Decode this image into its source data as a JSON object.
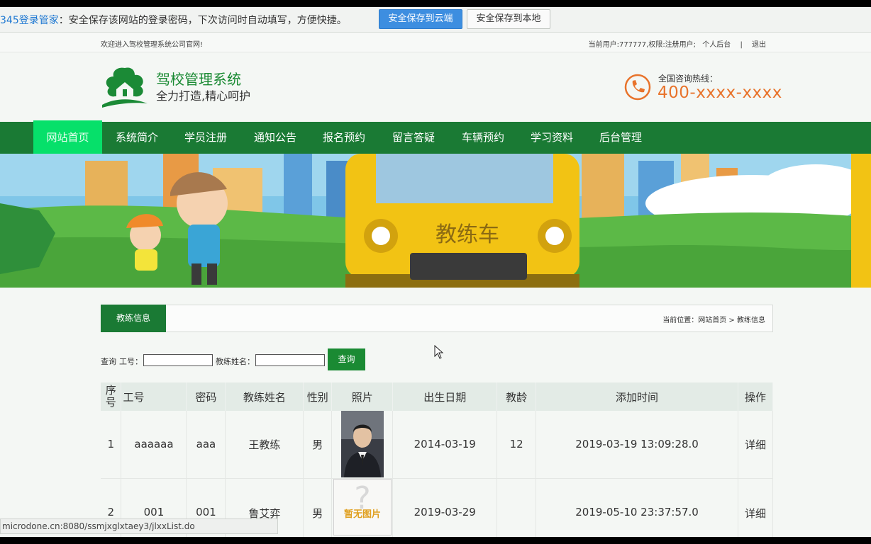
{
  "password_bar": {
    "brand": "345登录管家",
    "message": "：安全保存该网站的登录密码，下次访问时自动填写，方便快捷。",
    "save_cloud": "安全保存到云端",
    "save_local": "安全保存到本地"
  },
  "top_strip": {
    "welcome": "欢迎进入驾校管理系统公司官网!",
    "user_info": "当前用户:777777,权限:注册用户;",
    "personal_backend": "个人后台",
    "separator": "|",
    "logout": "退出"
  },
  "header": {
    "title": "驾校管理系统",
    "slogan": "全力打造,精心呵护",
    "hotline_label": "全国咨询热线：",
    "hotline_number": "400-xxxx-xxxx"
  },
  "nav": {
    "items": [
      "网站首页",
      "系统简介",
      "学员注册",
      "通知公告",
      "报名预约",
      "留言答疑",
      "车辆预约",
      "学习资料",
      "后台管理"
    ]
  },
  "banner": {
    "bus_text": "教练车"
  },
  "section": {
    "tab": "教练信息",
    "breadcrumb": "当前位置：网站首页 > 教练信息"
  },
  "search": {
    "query_label": "查询",
    "id_label": "工号：",
    "name_label": "教练姓名：",
    "id_value": "",
    "name_value": "",
    "button": "查询"
  },
  "table": {
    "headers": [
      "序号",
      "工号",
      "密码",
      "教练姓名",
      "性别",
      "照片",
      "出生日期",
      "教龄",
      "添加时间",
      "操作"
    ],
    "rows": [
      {
        "no": "1",
        "id": "aaaaaa",
        "password": "aaa",
        "name": "王教练",
        "gender": "男",
        "birth": "2014-03-19",
        "years": "12",
        "added": "2019-03-19 13:09:28.0",
        "action": "详细"
      },
      {
        "no": "2",
        "id": "001",
        "password": "001",
        "name": "鲁艾弈",
        "gender": "男",
        "birth": "2019-03-29",
        "years": "",
        "added": "2019-05-10 23:37:57.0",
        "action": "详细"
      }
    ],
    "no_image_text": "暂无图片"
  },
  "status_bar": {
    "url": "microdone.cn:8080/ssmjxglxtaey3/jlxxList.do"
  },
  "colors": {
    "nav_green": "#1a7a34",
    "active_nav": "#06e06a",
    "hotline_orange": "#e8732b",
    "title_green": "#1a8a33"
  }
}
